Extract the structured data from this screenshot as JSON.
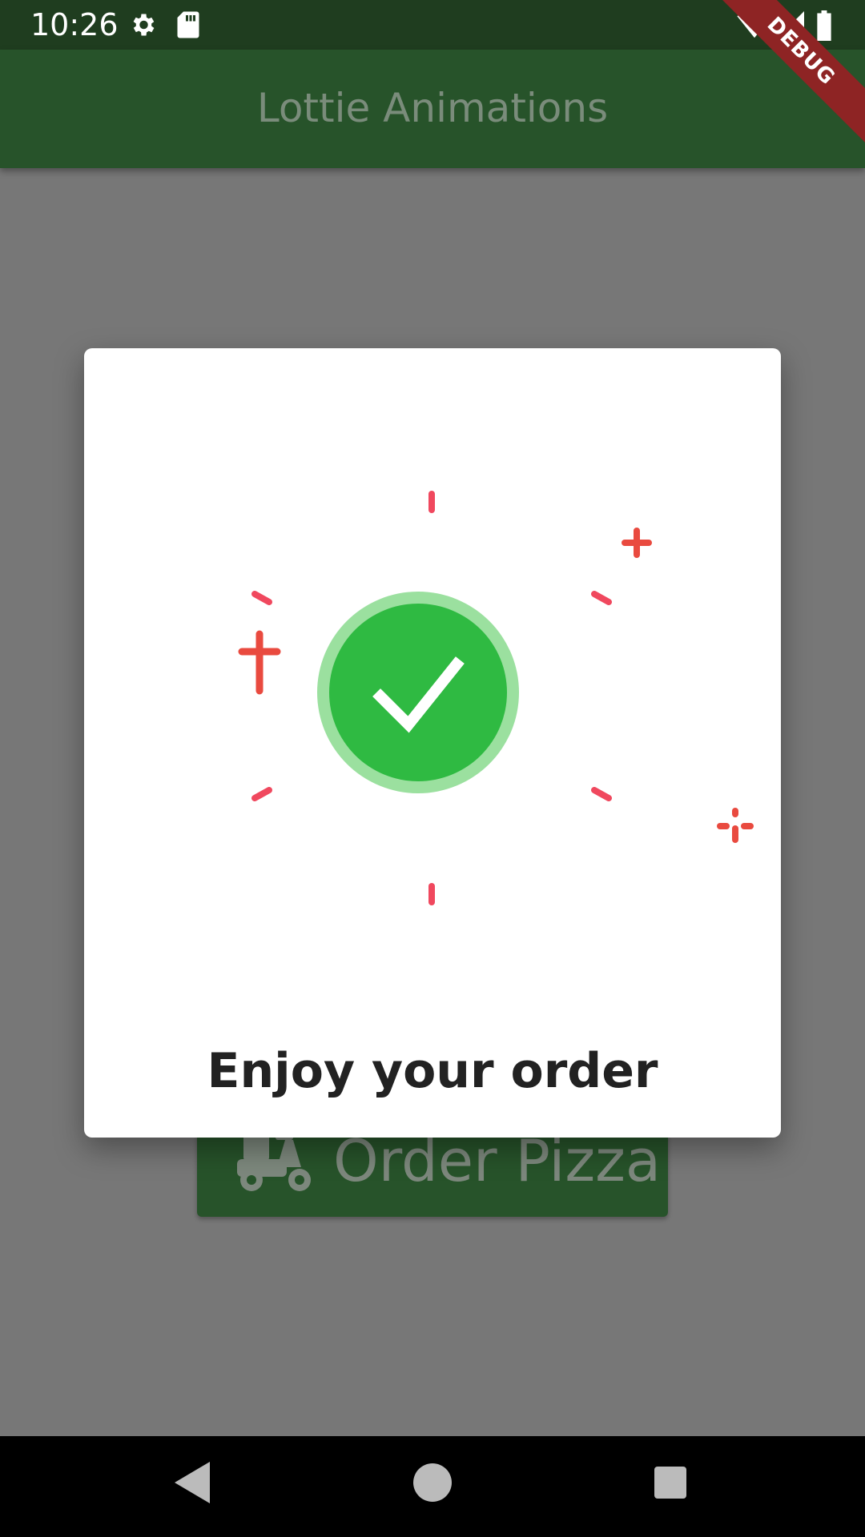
{
  "status_bar": {
    "time": "10:26",
    "icons_left": [
      "gear-icon",
      "sd-card-icon"
    ],
    "icons_right": [
      "wifi-icon",
      "cell-signal-icon",
      "battery-icon"
    ]
  },
  "app_bar": {
    "title": "Lottie Animations"
  },
  "debug_banner": {
    "label": "DEBUG"
  },
  "background": {
    "order_button": {
      "label": "Order Pizza",
      "icon": "delivery-scooter-icon"
    }
  },
  "dialog": {
    "animation": "success-check-icon",
    "message": "Enjoy your order",
    "colors": {
      "check_fill": "#2fba42",
      "check_ring": "#9be09f",
      "sparkle": "#f0485e"
    }
  },
  "nav_bar": {
    "buttons": [
      "back-icon",
      "home-icon",
      "recents-icon"
    ]
  }
}
